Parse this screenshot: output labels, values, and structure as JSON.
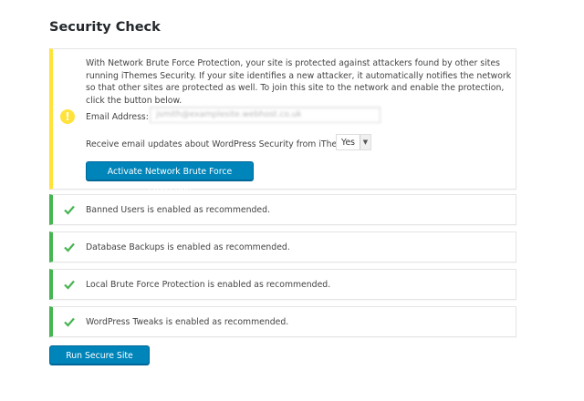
{
  "page": {
    "title": "Security Check"
  },
  "network_brute_force": {
    "description": "With Network Brute Force Protection, your site is protected against attackers found by other sites running iThemes Security. If your site identifies a new attacker, it automatically notifies the network so that other sites are protected as well. To join this site to the network and enable the protection, click the button below.",
    "email_label": "Email Address:",
    "email_value": "jsmith@examplesite.webhost.co.uk",
    "updates_label": "Receive email updates about WordPress Security from iThemes:",
    "updates_selected": "Yes",
    "activate_label": "Activate Network Brute Force Protection",
    "status_color": "#ffe23a"
  },
  "checks": [
    {
      "text": "Banned Users is enabled as recommended."
    },
    {
      "text": "Database Backups is enabled as recommended."
    },
    {
      "text": "Local Brute Force Protection is enabled as recommended."
    },
    {
      "text": "WordPress Tweaks is enabled as recommended."
    }
  ],
  "colors": {
    "success": "#46b450",
    "primary_button": "#0085ba",
    "warning": "#ffe23a"
  },
  "icons": {
    "warning": "exclamation-circle-icon",
    "success": "checkmark-icon"
  },
  "footer": {
    "run_again_label": "Run Secure Site Again"
  }
}
